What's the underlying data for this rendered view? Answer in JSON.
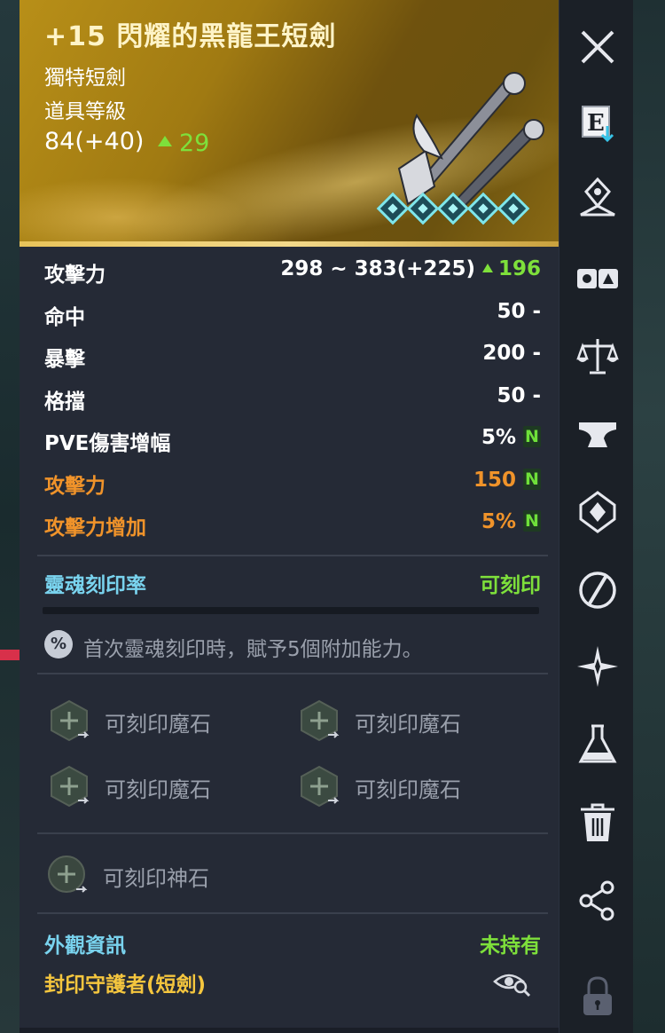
{
  "item": {
    "name": "+15 閃耀的黑龍王短劍",
    "type": "獨特短劍",
    "level_label": "道具等級",
    "level_value": "84(+40)",
    "level_diff": "29"
  },
  "stats": [
    {
      "label": "攻擊力",
      "value": "298 ~ 383(+225)",
      "diff": "196",
      "color": "white"
    },
    {
      "label": "命中",
      "value": "50 -",
      "color": "white"
    },
    {
      "label": "暴擊",
      "value": "200 -",
      "color": "white"
    },
    {
      "label": "格擋",
      "value": "50 -",
      "color": "white"
    },
    {
      "label": "PVE傷害增幅",
      "value": "5%",
      "badge": "N",
      "color": "white"
    },
    {
      "label": "攻擊力",
      "value": "150",
      "badge": "N",
      "color": "orange"
    },
    {
      "label": "攻擊力增加",
      "value": "5%",
      "badge": "N",
      "color": "orange"
    }
  ],
  "soul": {
    "label": "靈魂刻印率",
    "status": "可刻印",
    "note_icon": "%",
    "note": "首次靈魂刻印時，賦予5個附加能力。"
  },
  "manastones": [
    {
      "label": "可刻印魔石"
    },
    {
      "label": "可刻印魔石"
    },
    {
      "label": "可刻印魔石"
    },
    {
      "label": "可刻印魔石"
    }
  ],
  "godstone": {
    "label": "可刻印神石"
  },
  "appearance": {
    "label": "外觀資訊",
    "status": "未持有",
    "name": "封印守護者(短劍)"
  },
  "toolbar": {
    "buttons": [
      "close-icon",
      "equip-icon",
      "map-pin-icon",
      "compare-icon",
      "scales-icon",
      "anvil-icon",
      "gem-socket-icon",
      "swap-icon",
      "star-burst-icon",
      "potion-flask-icon",
      "trash-icon",
      "share-icon",
      "lock-icon"
    ]
  },
  "colors": {
    "gold_header": "#a07a12",
    "orange_stat": "#f0932a",
    "green": "#7ee03b",
    "cyan_label": "#79d3ee",
    "gold_name": "#f5c63e",
    "panel_bg": "#252a36"
  }
}
